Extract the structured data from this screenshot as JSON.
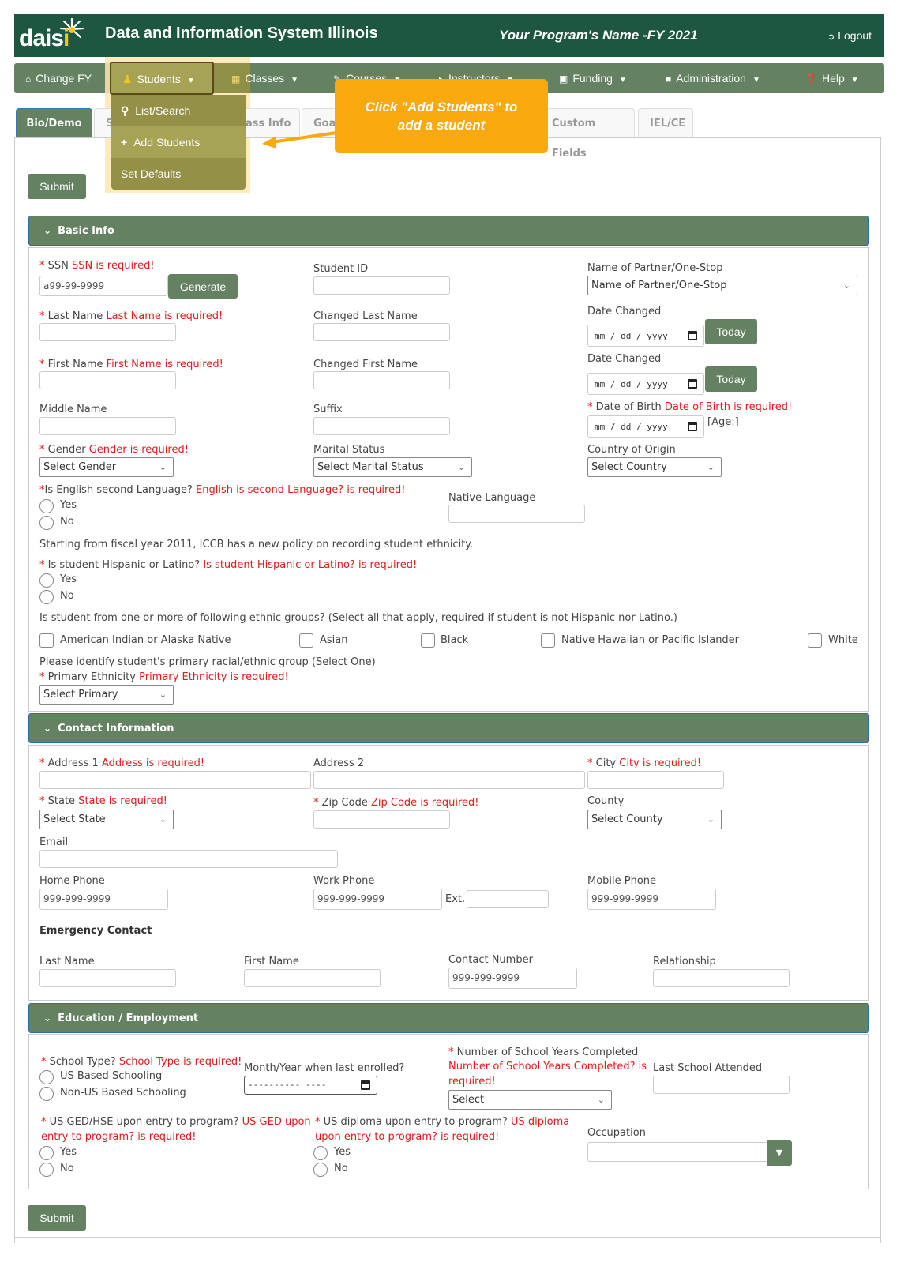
{
  "header": {
    "logo_text": "dais",
    "logo_i": "i",
    "app_title": "Data and Information System Illinois",
    "program_name": "Your Program's Name -FY 2021",
    "logout_label": "Logout",
    "logout_icon": "sign-out-icon"
  },
  "nav": {
    "items": [
      {
        "label": "Change FY",
        "icon": "home-icon",
        "has_caret": false
      },
      {
        "label": "Students",
        "icon": "user-icon",
        "has_caret": true,
        "active": true
      },
      {
        "label": "Classes",
        "icon": "building-icon",
        "has_caret": true
      },
      {
        "label": "Courses",
        "icon": "book-icon",
        "has_caret": true
      },
      {
        "label": "Instructors",
        "icon": "bullhorn-icon",
        "has_caret": true
      },
      {
        "label": "Funding",
        "icon": "money-icon",
        "has_caret": true
      },
      {
        "label": "Administration",
        "icon": "folder-icon",
        "has_caret": true
      },
      {
        "label": "Help",
        "icon": "question-circle-icon",
        "has_caret": true
      }
    ],
    "students_dropdown": [
      {
        "label": "List/Search",
        "icon": "search-icon"
      },
      {
        "label": "Add Students",
        "icon": "plus-icon",
        "highlighted": true
      },
      {
        "label": "Set Defaults",
        "icon": ""
      }
    ]
  },
  "callout": {
    "text_line1": "Click \"Add Students\" to",
    "text_line2": "add a student",
    "color": "#f7a90e"
  },
  "tabs": [
    {
      "label": "Bio/Demo",
      "active": true
    },
    {
      "label": "S",
      "active": false
    },
    {
      "label": "Class Info",
      "visible_part": "ass Info",
      "active": false
    },
    {
      "label": "Goal",
      "visible_part": "Goa",
      "active": false
    },
    {
      "label": "Custom Fields",
      "active": false
    },
    {
      "label": "IEL/CE",
      "active": false
    }
  ],
  "submit_label": "Submit",
  "basic_info": {
    "title": "Basic Info",
    "ssn": {
      "label": "SSN",
      "error": "SSN is required!",
      "value": "a99-99-9999",
      "generate_label": "Generate"
    },
    "student_id": {
      "label": "Student ID"
    },
    "partner": {
      "label": "Name of Partner/One-Stop",
      "selected": "Name of Partner/One-Stop"
    },
    "last_name": {
      "label": "Last Name",
      "error": "Last Name is required!"
    },
    "changed_last_name": {
      "label": "Changed Last Name"
    },
    "date_changed_1": {
      "label": "Date Changed",
      "placeholder": "mm / dd / yyyy",
      "today_label": "Today"
    },
    "first_name": {
      "label": "First Name",
      "error": "First Name is required!"
    },
    "changed_first_name": {
      "label": "Changed First Name"
    },
    "date_changed_2": {
      "label": "Date Changed",
      "placeholder": "mm / dd / yyyy",
      "today_label": "Today"
    },
    "middle_name": {
      "label": "Middle Name"
    },
    "suffix": {
      "label": "Suffix"
    },
    "dob": {
      "label": "Date of Birth",
      "error": "Date of Birth is required!",
      "placeholder": "mm / dd / yyyy",
      "age": "[Age:]"
    },
    "gender": {
      "label": "Gender",
      "error": "Gender is required!",
      "selected": "Select Gender"
    },
    "marital": {
      "label": "Marital Status",
      "selected": "Select Marital Status"
    },
    "country": {
      "label": "Country of Origin",
      "selected": "Select Country"
    },
    "esl": {
      "label": "Is English second Language?",
      "error": "English is second Language? is required!",
      "options": [
        "Yes",
        "No"
      ]
    },
    "native_language": {
      "label": "Native Language"
    },
    "ethnicity_note": "Starting from fiscal year 2011, ICCB has a new policy on recording student ethnicity.",
    "hispanic": {
      "label": "Is student Hispanic or Latino?",
      "error": "Is student Hispanic or Latino? is required!",
      "options": [
        "Yes",
        "No"
      ]
    },
    "ethnic_groups_label": "Is student from one or more of following ethnic groups? (Select all that apply, required if student is not Hispanic nor Latino.)",
    "ethnic_groups": [
      "American Indian or Alaska Native",
      "Asian",
      "Black",
      "Native Hawaiian or Pacific Islander",
      "White"
    ],
    "primary_note": "Please identify student's primary racial/ethnic group (Select One)",
    "primary": {
      "label": "Primary Ethnicity",
      "error": "Primary Ethnicity is required!",
      "selected": "Select Primary"
    }
  },
  "contact": {
    "title": "Contact Information",
    "address1": {
      "label": "Address 1",
      "error": "Address is required!"
    },
    "address2": {
      "label": "Address 2"
    },
    "city": {
      "label": "City",
      "error": "City is required!"
    },
    "state": {
      "label": "State",
      "error": "State is required!",
      "selected": "Select State"
    },
    "zip": {
      "label": "Zip Code",
      "error": "Zip Code is required!"
    },
    "county": {
      "label": "County",
      "selected": "Select County"
    },
    "email": {
      "label": "Email"
    },
    "home_phone": {
      "label": "Home Phone",
      "placeholder": "999-999-9999"
    },
    "work_phone": {
      "label": "Work Phone",
      "placeholder": "999-999-9999",
      "ext_label": "Ext."
    },
    "mobile_phone": {
      "label": "Mobile Phone",
      "placeholder": "999-999-9999"
    },
    "emergency_title": "Emergency Contact",
    "em_last_name": {
      "label": "Last Name"
    },
    "em_first_name": {
      "label": "First Name"
    },
    "em_contact_number": {
      "label": "Contact Number",
      "placeholder": "999-999-9999"
    },
    "em_relationship": {
      "label": "Relationship"
    }
  },
  "education": {
    "title": "Education / Employment",
    "school_type": {
      "label": "School Type?",
      "error": "School Type is required!",
      "options": [
        "US Based Schooling",
        "Non-US Based Schooling"
      ]
    },
    "last_enrolled": {
      "label": "Month/Year when last enrolled?",
      "placeholder": "---------- ----"
    },
    "years_completed": {
      "label": "Number of School Years Completed",
      "error_line1": "Number of School Years Completed? is",
      "error_line2": "required!",
      "selected": "Select"
    },
    "last_school": {
      "label": "Last School Attended"
    },
    "ged": {
      "label": "US GED/HSE upon entry to program?",
      "error_part1": "US GED upon",
      "error_part2": "entry to program? is required!",
      "options": [
        "Yes",
        "No"
      ]
    },
    "diploma": {
      "label": "US diploma upon entry to program?",
      "error_part1": "US diploma",
      "error_part2": "upon entry to program? is required!",
      "options": [
        "Yes",
        "No"
      ]
    },
    "occupation": {
      "label": "Occupation"
    }
  },
  "colors": {
    "header_bg": "#1e5741",
    "nav_bg": "#648262",
    "button_bg": "#648262",
    "error": "#e31b1b",
    "highlight": "#a6a356",
    "callout": "#f7a90e"
  }
}
